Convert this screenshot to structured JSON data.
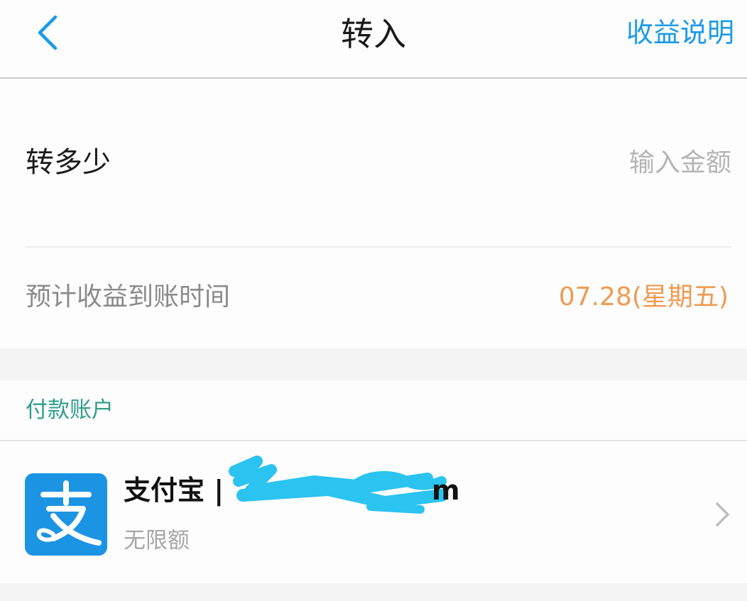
{
  "navbar": {
    "title": "转入",
    "right_label": "收益说明",
    "back_icon": "chevron-left-icon",
    "accent_color": "#1a9be8"
  },
  "amount": {
    "label": "转多少",
    "placeholder": "输入金额",
    "value": ""
  },
  "eta": {
    "label": "预计收益到账时间",
    "value": "07.28(星期五)",
    "value_color": "#ef9a52"
  },
  "payment": {
    "section_title": "付款账户",
    "section_color": "#2e9d8c",
    "account": {
      "icon": "alipay-logo",
      "provider": "支付宝",
      "separator": "|",
      "account_suffix": "m",
      "limit": "无限额",
      "chevron_icon": "chevron-right-icon"
    }
  }
}
